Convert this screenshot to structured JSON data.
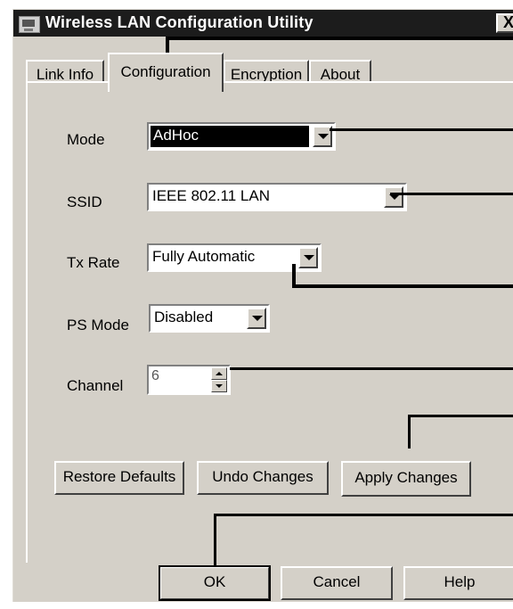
{
  "window": {
    "title": "Wireless LAN Configuration Utility",
    "close_glyph": "X",
    "icon": "app-window-icon"
  },
  "tabs": [
    {
      "label": "Link Info",
      "active": false
    },
    {
      "label": "Configuration",
      "active": true
    },
    {
      "label": "Encryption",
      "active": false
    },
    {
      "label": "About",
      "active": false
    }
  ],
  "form": {
    "mode": {
      "label": "Mode",
      "value": "AdHoc"
    },
    "ssid": {
      "label": "SSID",
      "value": "IEEE 802.11 LAN"
    },
    "tx_rate": {
      "label": "Tx Rate",
      "value": "Fully Automatic"
    },
    "ps_mode": {
      "label": "PS Mode",
      "value": "Disabled"
    },
    "channel": {
      "label": "Channel",
      "value": "6"
    }
  },
  "actions": {
    "restore": "Restore Defaults",
    "undo": "Undo Changes",
    "apply": "Apply Changes"
  },
  "dialog_buttons": {
    "ok": "OK",
    "cancel": "Cancel",
    "help": "Help"
  },
  "colors": {
    "window_face": "#d4d0c8",
    "titlebar": "#1c1c1c",
    "selection": "#000000",
    "callout_lines": "#000000"
  }
}
